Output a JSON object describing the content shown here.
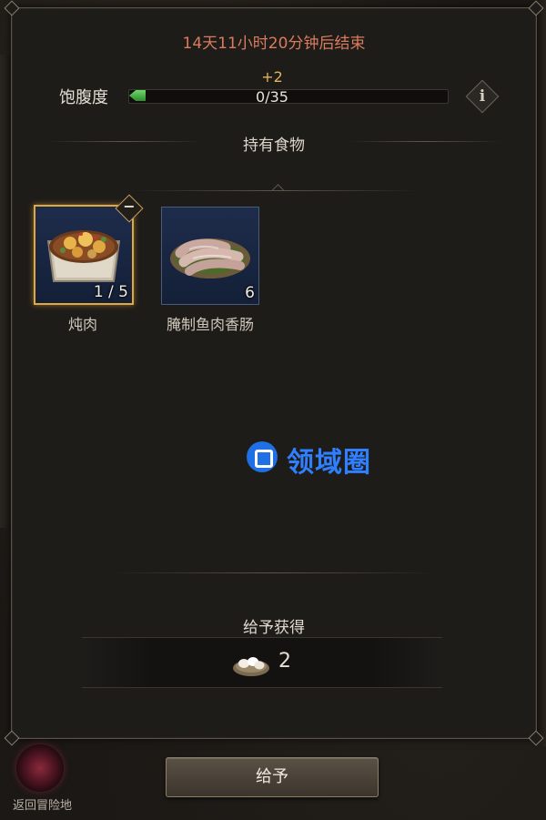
{
  "event": {
    "timer": "14天11小时20分钟后结束"
  },
  "satiety": {
    "label": "饱腹度",
    "gain": "+2",
    "value": "0/35",
    "fill_fraction": 0
  },
  "food_section": {
    "title": "持有食物"
  },
  "food_items": [
    {
      "name": "炖肉",
      "qty": "1 / 5",
      "selected": true
    },
    {
      "name": "腌制鱼肉香肠",
      "qty": "6",
      "selected": false
    }
  ],
  "reward": {
    "title": "给予获得",
    "count": "2",
    "icon": "eggs-icon"
  },
  "actions": {
    "give_label": "给予"
  },
  "nav": {
    "back_label": "返回冒险地"
  },
  "watermark": {
    "text": "领域圈"
  },
  "colors": {
    "timer": "#d97b5e",
    "gain": "#e2b25f",
    "selected_border": "#e0a843",
    "watermark": "#2f7fff"
  }
}
